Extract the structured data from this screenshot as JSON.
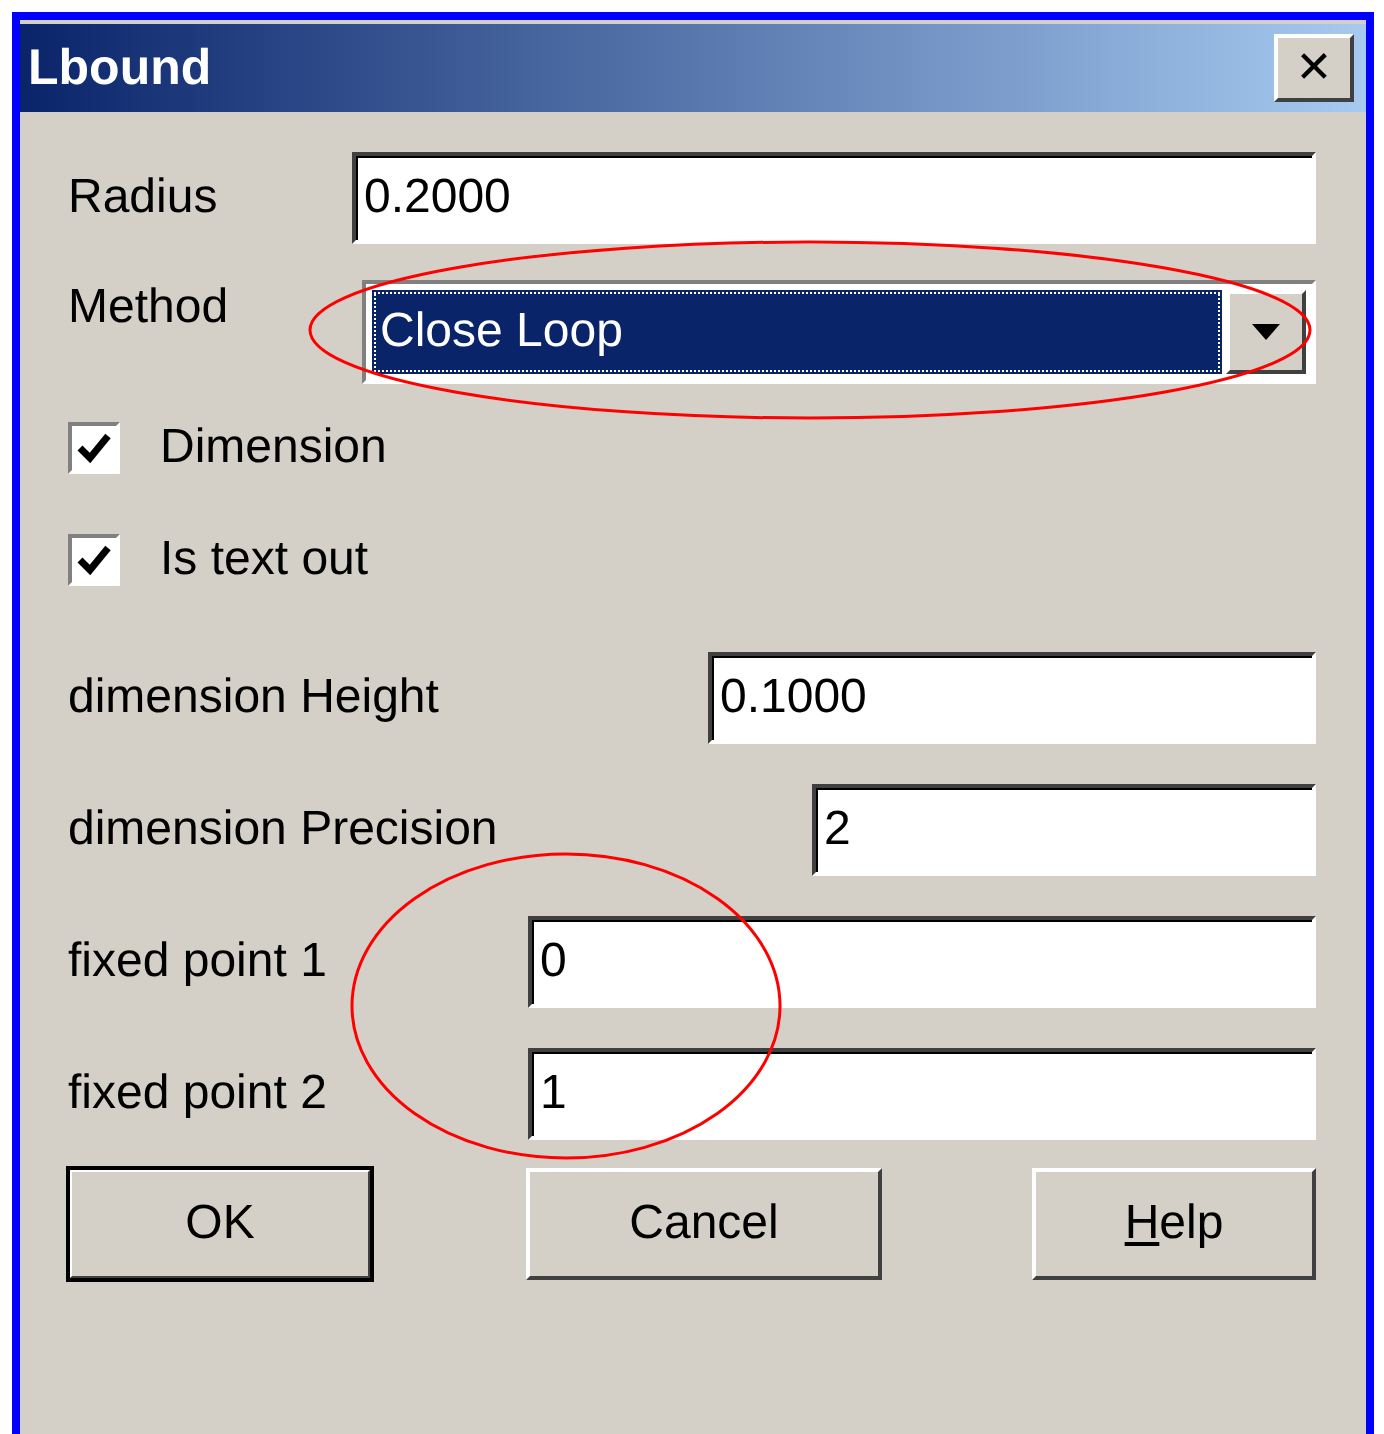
{
  "window": {
    "title": "Lbound",
    "close": "✕"
  },
  "radius": {
    "label": "Radius",
    "value": "0.2000"
  },
  "method": {
    "label": "Method",
    "value": "Close Loop",
    "focused": true
  },
  "checkboxes": [
    {
      "label": "Dimension",
      "checked": true
    },
    {
      "label": "Is text out",
      "checked": true
    }
  ],
  "fields": [
    {
      "label": "dimension Height",
      "value": "0.1000"
    },
    {
      "label": "dimension Precision",
      "value": "2"
    },
    {
      "label": "fixed point 1",
      "value": "0"
    },
    {
      "label": "fixed point 2",
      "value": "1"
    }
  ],
  "buttons": [
    {
      "label": "OK",
      "default": true
    },
    {
      "label": "Cancel",
      "default": false
    },
    {
      "mnemonic": "H",
      "rest": "elp",
      "default": false
    }
  ],
  "annotations": [
    {
      "kind": "ellipse",
      "color": "#ff0000"
    },
    {
      "kind": "ellipse",
      "color": "#ff0000"
    }
  ]
}
